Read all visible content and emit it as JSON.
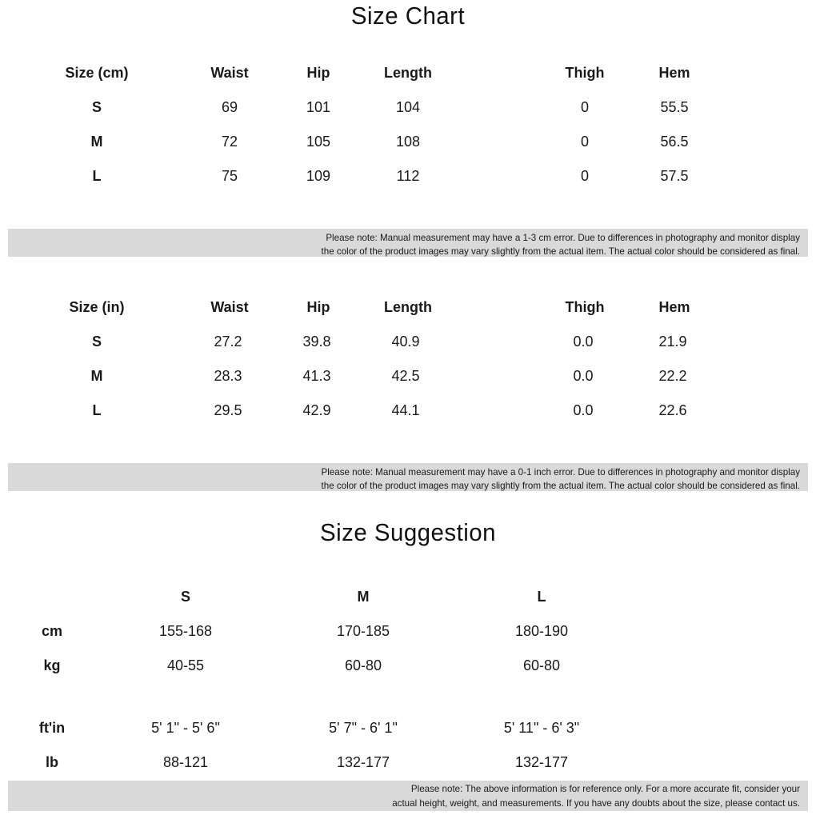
{
  "size_chart": {
    "title": "Size Chart",
    "cm_table": {
      "headers": [
        "Size (cm)",
        "Waist",
        "Hip",
        "Length",
        "Thigh",
        "Hem"
      ],
      "rows": [
        [
          "S",
          "69",
          "101",
          "104",
          "0",
          "55.5"
        ],
        [
          "M",
          "72",
          "105",
          "108",
          "0",
          "56.5"
        ],
        [
          "L",
          "75",
          "109",
          "112",
          "0",
          "57.5"
        ]
      ],
      "note": [
        "Please note: Manual measurement may have a 1-3 cm error. Due to differences in photography and monitor display",
        "the color of the product images may vary slightly from the actual item. The actual color should be considered as final."
      ]
    },
    "in_table": {
      "headers": [
        "Size (in)",
        "Waist",
        "Hip",
        "Length",
        "Thigh",
        "Hem"
      ],
      "rows": [
        [
          "S",
          "27.2",
          "39.8",
          "40.9",
          "0.0",
          "21.9"
        ],
        [
          "M",
          "28.3",
          "41.3",
          "42.5",
          "0.0",
          "22.2"
        ],
        [
          "L",
          "29.5",
          "42.9",
          "44.1",
          "0.0",
          "22.6"
        ]
      ],
      "note": [
        "Please note: Manual measurement may have a 0-1 inch error. Due to differences in photography and monitor display",
        "the color of the product images may vary slightly from the actual item. The actual color should be considered as final."
      ]
    }
  },
  "size_suggestion": {
    "title": "Size Suggestion",
    "sizes": [
      "S",
      "M",
      "L"
    ],
    "metric_rows": [
      {
        "label": "cm",
        "values": [
          "155-168",
          "170-185",
          "180-190"
        ]
      },
      {
        "label": "kg",
        "values": [
          "40-55",
          "60-80",
          "60-80"
        ]
      }
    ],
    "imperial_rows": [
      {
        "label": "ft'in",
        "values": [
          "5' 1\" - 5' 6\"",
          "5' 7\" - 6' 1\"",
          "5' 11\" - 6' 3\""
        ]
      },
      {
        "label": "lb",
        "values": [
          "88-121",
          "132-177",
          "132-177"
        ]
      }
    ],
    "note": [
      "Please note: The above information is for reference only. For a more accurate fit, consider your",
      "actual height, weight, and measurements. If you have any doubts about the size, please contact us."
    ]
  },
  "colors": {
    "background": "#ffffff",
    "text": "#111111",
    "note_band": "#d9d9d9"
  }
}
